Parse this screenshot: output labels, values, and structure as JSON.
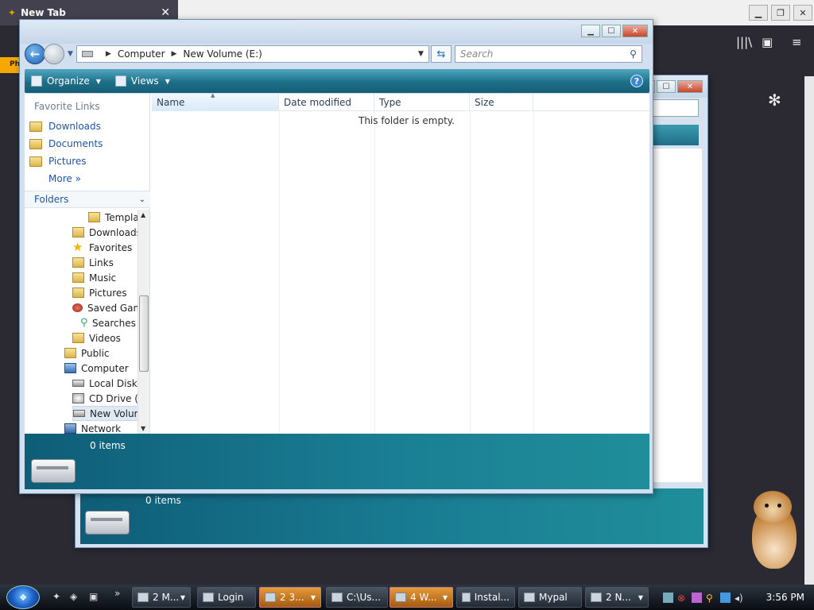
{
  "browser": {
    "tab_title": "New Tab",
    "tab_close": "✕",
    "new_tab": "+",
    "left_strip": "Ph",
    "gear": "✻",
    "library_icon": "|||\\",
    "sidebar_icon": "▣",
    "menu_icon": "≡"
  },
  "explorer_back": {
    "status": {
      "count": "0 items"
    }
  },
  "explorer": {
    "breadcrumb": [
      "Computer",
      "New Volume (E:)"
    ],
    "search_placeholder": "Search",
    "toolbar": {
      "organize": "Organize",
      "views": "Views",
      "help": "?"
    },
    "favorite_links_title": "Favorite Links",
    "favorite_links": [
      "Downloads",
      "Documents",
      "Pictures"
    ],
    "more": "More",
    "folders_header": "Folders",
    "tree": [
      {
        "label": "Templates",
        "icon": "folder"
      },
      {
        "label": "Downloads",
        "icon": "folder"
      },
      {
        "label": "Favorites",
        "icon": "star"
      },
      {
        "label": "Links",
        "icon": "folder"
      },
      {
        "label": "Music",
        "icon": "folder"
      },
      {
        "label": "Pictures",
        "icon": "folder"
      },
      {
        "label": "Saved Games",
        "icon": "game"
      },
      {
        "label": "Searches",
        "icon": "search"
      },
      {
        "label": "Videos",
        "icon": "folder"
      },
      {
        "label": "Public",
        "icon": "folder"
      },
      {
        "label": "Computer",
        "icon": "computer"
      },
      {
        "label": "Local Disk (C:)",
        "icon": "drive"
      },
      {
        "label": "CD Drive (D:)",
        "icon": "cd"
      },
      {
        "label": "New Volume (E:)",
        "icon": "drive",
        "selected": true
      },
      {
        "label": "Network",
        "icon": "network"
      }
    ],
    "columns": [
      "Name",
      "Date modified",
      "Type",
      "Size"
    ],
    "empty_message": "This folder is empty.",
    "status": {
      "count": "0 items"
    }
  },
  "taskbar": {
    "buttons": [
      {
        "label": "2 M...",
        "active": false
      },
      {
        "label": "Login",
        "active": false
      },
      {
        "label": "2 3...",
        "active": true
      },
      {
        "label": "C:\\Us...",
        "active": false
      },
      {
        "label": "4 W...",
        "active": true
      },
      {
        "label": "Instal...",
        "active": false
      },
      {
        "label": "Mypal",
        "active": false
      },
      {
        "label": "2 N...",
        "active": false
      }
    ],
    "clock": "3:56 PM"
  }
}
